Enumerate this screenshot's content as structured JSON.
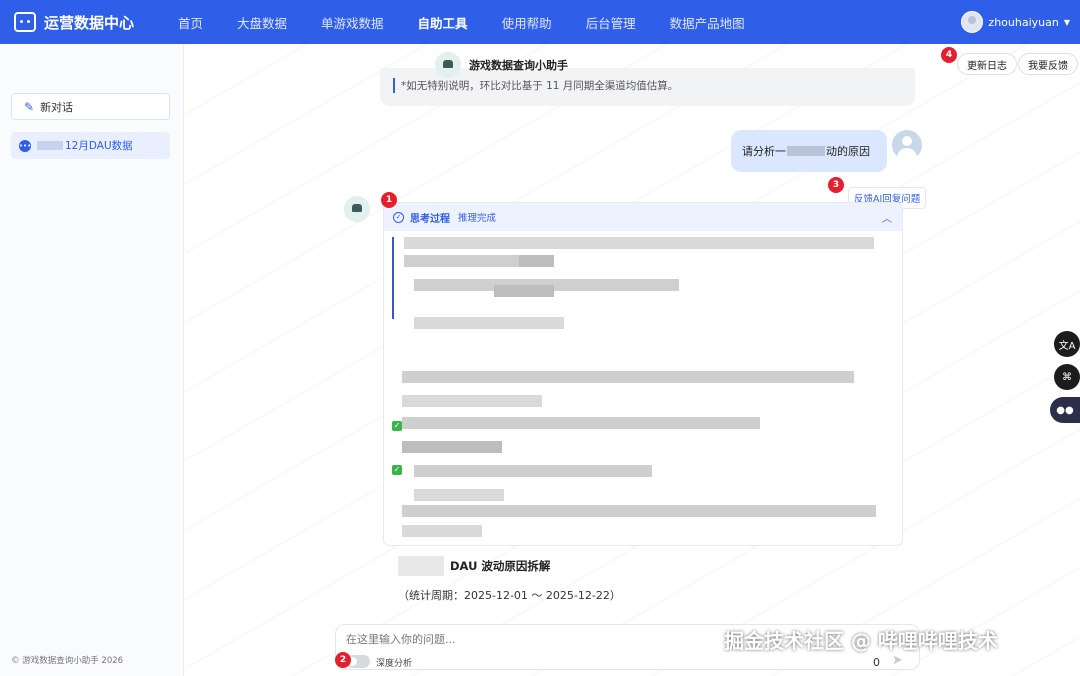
{
  "app": {
    "title": "运营数据中心",
    "nav": [
      "首页",
      "大盘数据",
      "单游戏数据",
      "自助工具",
      "使用帮助",
      "后台管理",
      "数据产品地图"
    ],
    "active_nav": "自助工具",
    "user": "zhouhaiyuan",
    "accent_color": "#2f5ee8"
  },
  "sidebar": {
    "new_chat": "新对话",
    "conversation": "12月DAU数据",
    "footer": "© 游戏数据查询小助手 2026"
  },
  "main": {
    "assistant_title": "游戏数据查询小助手",
    "buttons": {
      "changelog": "更新日志",
      "feedback": "我要反馈"
    },
    "prev_msg": "*如无特别说明，环比对比基于 11 月同期全渠道均值估算。",
    "user_message_pre": "请分析一",
    "user_message_post": "动的原因",
    "feedback_ai": "反馈AI回复问题",
    "thinking": {
      "title": "思考过程",
      "status": "推理完成"
    },
    "section_title": "DAU 波动原因拆解",
    "period": "（统计周期：2025-12-01 ～ 2025-12-22）",
    "input_placeholder": "在这里输入你的问题...",
    "deep_analysis": "深度分析",
    "char_count": "0"
  },
  "annotations": [
    "1",
    "2",
    "3",
    "4"
  ],
  "watermark": "掘金技术社区 @ 哔哩哔哩技术",
  "icons": [
    "logo-icon",
    "caret-down-icon",
    "edit-icon",
    "chat-icon",
    "check-circle-icon",
    "chevron-up-icon",
    "send-icon",
    "translate-icon",
    "grid-icon",
    "bot-icon"
  ]
}
